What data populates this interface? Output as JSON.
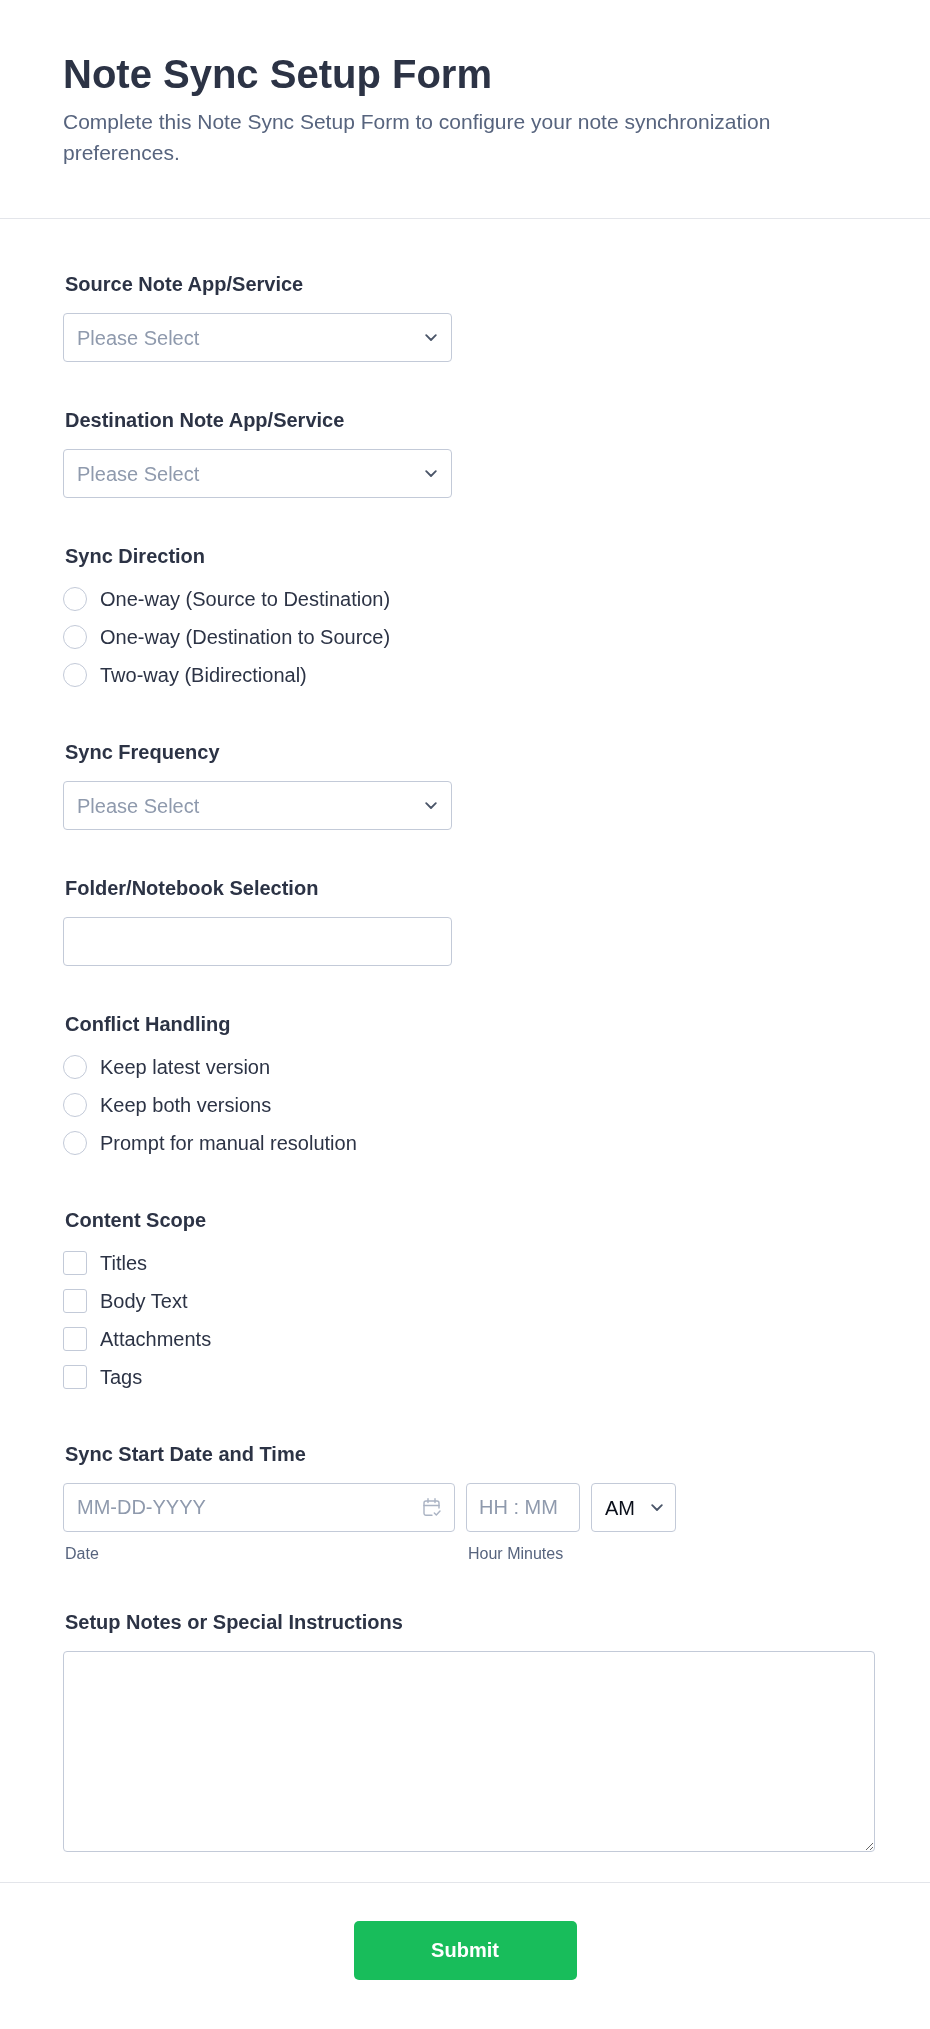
{
  "header": {
    "title": "Note Sync Setup Form",
    "description": "Complete this Note Sync Setup Form to configure your note synchronization preferences."
  },
  "fields": [
    {
      "kind": "select",
      "label": "Source Note App/Service",
      "placeholder": "Please Select"
    },
    {
      "kind": "select",
      "label": "Destination Note App/Service",
      "placeholder": "Please Select"
    },
    {
      "kind": "radio",
      "label": "Sync Direction",
      "options": [
        {
          "label": "One-way (Source to Destination)",
          "selected": false
        },
        {
          "label": "One-way (Destination to Source)",
          "selected": false
        },
        {
          "label": "Two-way (Bidirectional)",
          "selected": false
        }
      ]
    },
    {
      "kind": "select",
      "label": "Sync Frequency",
      "placeholder": "Please Select"
    },
    {
      "kind": "text",
      "label": "Folder/Notebook Selection"
    },
    {
      "kind": "radio",
      "label": "Conflict Handling",
      "options": [
        {
          "label": "Keep latest version",
          "selected": false
        },
        {
          "label": "Keep both versions",
          "selected": false
        },
        {
          "label": "Prompt for manual resolution",
          "selected": false
        }
      ]
    },
    {
      "kind": "checkbox",
      "label": "Content Scope",
      "options": [
        {
          "label": "Titles",
          "checked": false
        },
        {
          "label": "Body Text",
          "checked": false
        },
        {
          "label": "Attachments",
          "checked": false
        },
        {
          "label": "Tags",
          "checked": false
        }
      ]
    },
    {
      "kind": "datetime",
      "label": "Sync Start Date and Time",
      "date": {
        "placeholder": "MM-DD-YYYY",
        "sublabel": "Date"
      },
      "time": {
        "placeholder": "HH : MM",
        "sublabel": "Hour Minutes"
      },
      "ampm": {
        "value": "AM"
      }
    },
    {
      "kind": "textarea",
      "label": "Setup Notes or Special Instructions"
    }
  ],
  "submit": {
    "label": "Submit"
  }
}
